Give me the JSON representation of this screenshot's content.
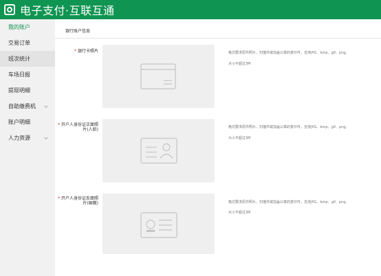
{
  "app": {
    "title": "电子支付·互联互通"
  },
  "sidebar": {
    "items": [
      {
        "label": "我的账户",
        "active": true
      },
      {
        "label": "交易订单"
      },
      {
        "label": "班次统计",
        "selected": true
      },
      {
        "label": "车场日报"
      },
      {
        "label": "提现明细"
      },
      {
        "label": "自助缴费机",
        "expandable": true
      },
      {
        "label": "账户明细"
      },
      {
        "label": "人力资源",
        "expandable": true
      }
    ]
  },
  "main": {
    "section_title": "银行账户信息",
    "fields": [
      {
        "required_mark": "*",
        "label": "银行卡照片",
        "icon": "bank-card-icon",
        "help_format": "格式要求原件照片、扫描件或加盖公章的复印件，支持JPG、bmp、gif、png。",
        "help_size": "大小不超过3M"
      },
      {
        "required_mark": "*",
        "label": "开户人身份证正面照片(人脸)",
        "icon": "id-card-front-icon",
        "help_format": "格式要求原件照片、扫描件或加盖公章的复印件，支持JPG、bmp、gif、png。",
        "help_size": "大小不超过3M"
      },
      {
        "required_mark": "*",
        "label": "开户人身份证反面照片(国徽)",
        "icon": "id-card-back-icon",
        "help_format": "格式要求原件照片、扫描件或加盖公章的复印件，支持JPG、bmp、gif、png。",
        "help_size": "大小不超过3M"
      }
    ]
  },
  "colors": {
    "brand": "#109451",
    "required": "#e02020",
    "placeholder_bg": "#efefef"
  }
}
